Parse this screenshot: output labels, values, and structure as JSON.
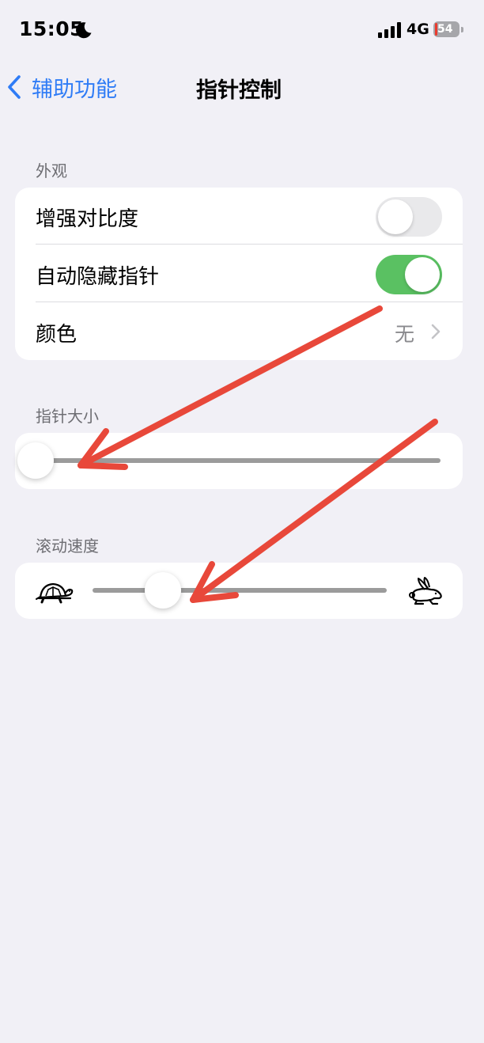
{
  "status_bar": {
    "time": "15:05",
    "network": "4G",
    "battery_level": "54"
  },
  "nav": {
    "back_label": "辅助功能",
    "title": "指针控制"
  },
  "appearance": {
    "header": "外观",
    "rows": [
      {
        "label": "增强对比度",
        "toggle": "off"
      },
      {
        "label": "自动隐藏指针",
        "toggle": "on"
      },
      {
        "label": "颜色",
        "value": "无"
      }
    ]
  },
  "pointer_size": {
    "header": "指针大小",
    "value": 0
  },
  "scroll_speed": {
    "header": "滚动速度",
    "value": 0.24,
    "min_icon": "turtle-icon",
    "max_icon": "rabbit-icon"
  },
  "colors": {
    "accent": "#2f7cf6",
    "toggle_on": "#5ac162",
    "annotation_arrow": "#e8483a"
  }
}
